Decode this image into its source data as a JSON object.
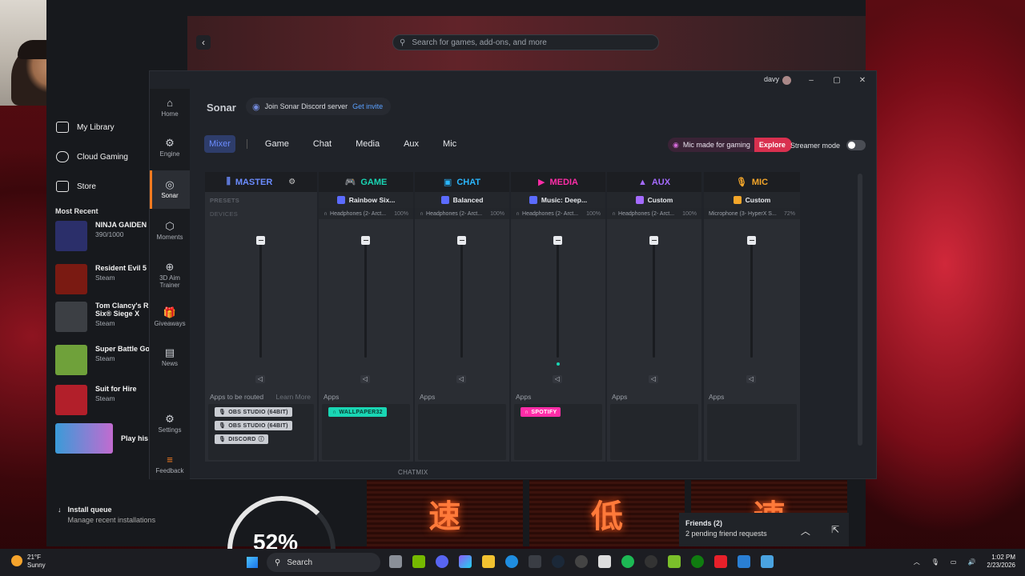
{
  "launcher": {
    "search_placeholder": "Search for games, add-ons, and more",
    "back_label": "‹",
    "nav": [
      {
        "label": "My Library"
      },
      {
        "label": "Cloud Gaming"
      },
      {
        "label": "Store"
      }
    ],
    "most_recent_label": "Most Recent",
    "recent_games": [
      {
        "title": "NINJA GAIDEN",
        "sub": "390/1000",
        "color": "#2b2f6a"
      },
      {
        "title": "Resident Evil 5",
        "sub": "Steam",
        "color": "#7a1a12"
      },
      {
        "title": "Tom Clancy's R Six® Siege X",
        "sub": "Steam",
        "color": "#3c3f44"
      },
      {
        "title": "Super Battle Go",
        "sub": "Steam",
        "color": "#6fa13a"
      },
      {
        "title": "Suit for Hire",
        "sub": "Steam",
        "color": "#b21f2a"
      },
      {
        "title": "Play his",
        "sub": "",
        "color": "#c26bd0"
      }
    ],
    "install_queue_title": "Install queue",
    "install_queue_sub": "Manage recent installations",
    "progress_text": "52%",
    "friends_title": "Friends (2)",
    "friends_sub": "2 pending friend requests"
  },
  "sonar": {
    "user": "davy",
    "title": "Sonar",
    "discord_text": "Join Sonar Discord server",
    "discord_link": "Get invite",
    "nav": [
      {
        "label": "Home",
        "icon": "⌂"
      },
      {
        "label": "Engine",
        "icon": "⚙"
      },
      {
        "label": "Sonar",
        "icon": "◎"
      },
      {
        "label": "Moments",
        "icon": "⬡"
      },
      {
        "label": "3D Aim Trainer",
        "icon": "⊕"
      },
      {
        "label": "Giveaways",
        "icon": "🎁"
      },
      {
        "label": "News",
        "icon": "▤"
      },
      {
        "label": "Settings",
        "icon": "⚙"
      },
      {
        "label": "Feedback",
        "icon": "≡"
      }
    ],
    "tabs": [
      "Mixer",
      "Game",
      "Chat",
      "Media",
      "Aux",
      "Mic"
    ],
    "mic_promo": "Mic made for gaming",
    "mic_explore": "Explore",
    "streamer_mode": "Streamer mode",
    "presets_label": "PRESETS",
    "devices_label": "DEVICES",
    "apps_to_be_routed": "Apps to be routed",
    "learn_more": "Learn More",
    "apps_label": "Apps",
    "chatmix_label": "CHATMIX",
    "channels": [
      {
        "name": "MASTER",
        "color": "#6b8cff",
        "icon": "⫼",
        "preset": "",
        "device": "",
        "pct": "",
        "apps": [
          "OBS STUDIO (64BIT)",
          "OBS STUDIO (64BIT)",
          "DISCORD"
        ],
        "volume_pct": 100
      },
      {
        "name": "GAME",
        "color": "#19d6b4",
        "icon": "🎮",
        "preset": "Rainbow Six...",
        "preset_color": "#5b6bff",
        "device": "Headphones (2- Arct...",
        "pct": "100%",
        "apps": [
          "WALLPAPER32"
        ],
        "volume_pct": 100
      },
      {
        "name": "CHAT",
        "color": "#2ab7ff",
        "icon": "▣",
        "preset": "Balanced",
        "preset_color": "#5b6bff",
        "device": "Headphones (2- Arct...",
        "pct": "100%",
        "apps": [],
        "volume_pct": 100
      },
      {
        "name": "MEDIA",
        "color": "#ff2da8",
        "icon": "▶",
        "preset": "Music: Deep...",
        "preset_color": "#5b6bff",
        "device": "Headphones (2- Arct...",
        "pct": "100%",
        "apps": [
          "SPOTIFY"
        ],
        "volume_pct": 100
      },
      {
        "name": "AUX",
        "color": "#a56bff",
        "icon": "▲",
        "preset": "Custom",
        "preset_color": "#a56bff",
        "device": "Headphones (2- Arct...",
        "pct": "100%",
        "apps": [],
        "volume_pct": 100
      },
      {
        "name": "MIC",
        "color": "#f4a62a",
        "icon": "🎙",
        "preset": "Custom",
        "preset_color": "#f4a62a",
        "device": "Microphone (3- HyperX S...",
        "pct": "72%",
        "apps": [],
        "volume_pct": 100
      }
    ]
  },
  "taskbar": {
    "temp": "21°F",
    "weather": "Sunny",
    "search": "Search",
    "time": "1:02 PM",
    "date": "2/23/2026"
  }
}
